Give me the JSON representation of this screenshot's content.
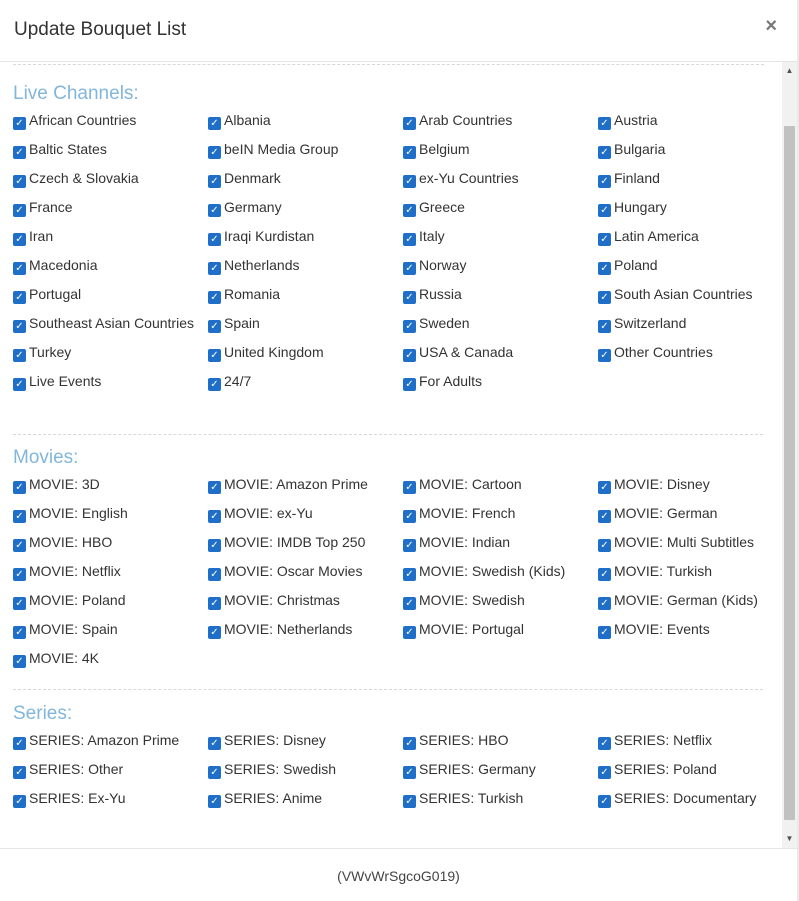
{
  "modal": {
    "title": "Update Bouquet List",
    "close_label": "×",
    "footer_code": "(VWvWrSgcoG019)"
  },
  "sections": {
    "live": {
      "title": "Live Channels:",
      "items": [
        "African Countries",
        "Albania",
        "Arab Countries",
        "Austria",
        "Baltic States",
        "beIN Media Group",
        "Belgium",
        "Bulgaria",
        "Czech & Slovakia",
        "Denmark",
        "ex-Yu Countries",
        "Finland",
        "France",
        "Germany",
        "Greece",
        "Hungary",
        "Iran",
        "Iraqi Kurdistan",
        "Italy",
        "Latin America",
        "Macedonia",
        "Netherlands",
        "Norway",
        "Poland",
        "Portugal",
        "Romania",
        "Russia",
        "South Asian Countries",
        "Southeast Asian Countries",
        "Spain",
        "Sweden",
        "Switzerland",
        "Turkey",
        "United Kingdom",
        "USA & Canada",
        "Other Countries",
        "Live Events",
        "24/7",
        "For Adults"
      ]
    },
    "movies": {
      "title": "Movies:",
      "items": [
        "MOVIE: 3D",
        "MOVIE: Amazon Prime",
        "MOVIE: Cartoon",
        "MOVIE: Disney",
        "MOVIE: English",
        "MOVIE: ex-Yu",
        "MOVIE: French",
        "MOVIE: German",
        "MOVIE: HBO",
        "MOVIE: IMDB Top 250",
        "MOVIE: Indian",
        "MOVIE: Multi Subtitles",
        "MOVIE: Netflix",
        "MOVIE: Oscar Movies",
        "MOVIE: Swedish (Kids)",
        "MOVIE: Turkish",
        "MOVIE: Poland",
        "MOVIE: Christmas",
        "MOVIE: Swedish",
        "MOVIE: German (Kids)",
        "MOVIE: Spain",
        "MOVIE: Netherlands",
        "MOVIE: Portugal",
        "MOVIE: Events",
        "MOVIE: 4K"
      ]
    },
    "series": {
      "title": "Series:",
      "items": [
        "SERIES: Amazon Prime",
        "SERIES: Disney",
        "SERIES: HBO",
        "SERIES: Netflix",
        "SERIES: Other",
        "SERIES: Swedish",
        "SERIES: Germany",
        "SERIES: Poland",
        "SERIES: Ex-Yu",
        "SERIES: Anime",
        "SERIES: Turkish",
        "SERIES: Documentary"
      ]
    }
  },
  "checkbox_state": "checked",
  "checkbox_glyph": "✓",
  "colors": {
    "section_title": "#82b6dc",
    "checkbox": "#1f6fc9"
  }
}
